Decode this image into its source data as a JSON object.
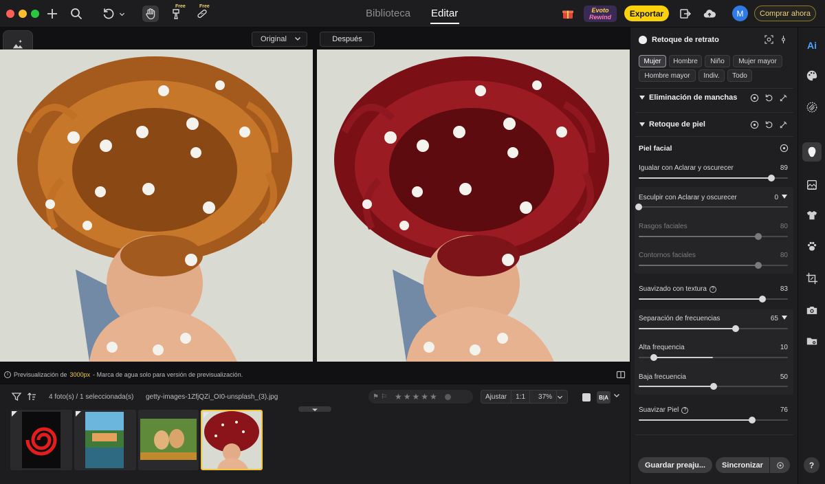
{
  "window": {
    "dot_colors": [
      "#ff5f57",
      "#febc2e",
      "#28c840"
    ]
  },
  "toolbar": {
    "free_tag": "Free",
    "mode_library": "Biblioteca",
    "mode_edit": "Editar",
    "rewind_badge_line1": "Evoto",
    "rewind_badge_line2": "Rewind",
    "export_label": "Exportar",
    "avatar_initial": "M",
    "buy_label": "Comprar ahora",
    "accent": "#fbd10b"
  },
  "canvas": {
    "compare_mode": "Original",
    "after_label": "Después",
    "preview_note_prefix": "Previsualización de",
    "preview_note_size": "3000px",
    "preview_note_suffix": "- Marca de agua solo para versión de previsualización."
  },
  "filmstrip": {
    "count_text": "4 foto(s) / 1 seleccionada(s)",
    "file_name": "getty-images-1ZfjQZi_OI0-unsplash_(3).jpg",
    "fit_label": "Ajustar",
    "one_to_one_label": "1:1",
    "zoom_value": "37%",
    "compare_badge": "B|A",
    "stars": "★★★★★"
  },
  "panel": {
    "title": "Retoque de retrato",
    "ai_label": "Ai",
    "chips": [
      "Mujer",
      "Hombre",
      "Niño",
      "Mujer mayor",
      "Hombre mayor",
      "Indiv.",
      "Todo"
    ],
    "selected_chip": "Mujer",
    "section_spots": "Eliminación de manchas",
    "section_skin": "Retoque de piel",
    "subsection_face": "Piel facial",
    "sliders": {
      "even": {
        "label": "Igualar con Aclarar y oscurecer",
        "value": 89
      },
      "sculpt": {
        "label": "Esculpir con Aclarar y oscurecer",
        "value": 0
      },
      "features": {
        "label": "Rasgos faciales",
        "value": 80
      },
      "contours": {
        "label": "Contornos faciales",
        "value": 80
      },
      "texture": {
        "label": "Suavizado con textura",
        "value": 83
      },
      "freqsep": {
        "label": "Separación de frecuencias",
        "value": 65
      },
      "highfreq": {
        "label": "Alta frequencia",
        "value": 10
      },
      "lowfreq": {
        "label": "Baja frecuencia",
        "value": 50
      },
      "smooth": {
        "label": "Suavizar Piel",
        "value": 76
      }
    },
    "save_preset_label": "Guardar preaju...",
    "sync_label": "Sincronizar"
  },
  "rail": {
    "help_label": "?"
  }
}
